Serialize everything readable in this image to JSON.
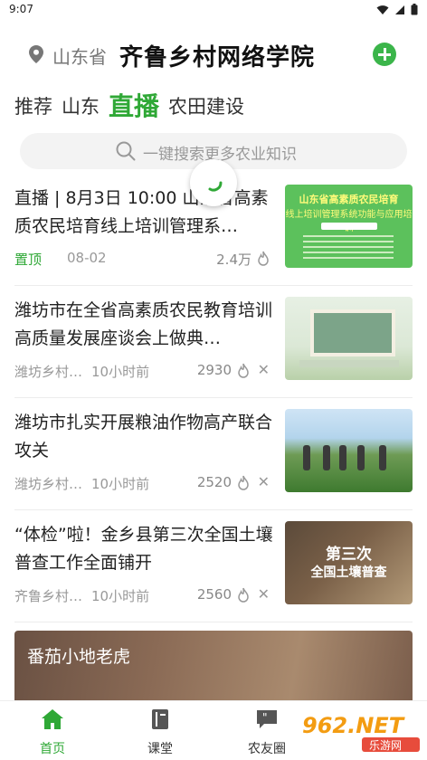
{
  "status_bar": {
    "time": "9:07"
  },
  "header": {
    "location": "山东省",
    "title": "齐鲁乡村网络学院",
    "add_icon": "plus-icon"
  },
  "tabs": [
    {
      "label": "推荐",
      "active": false
    },
    {
      "label": "山东",
      "active": false
    },
    {
      "label": "直播",
      "active": true
    },
    {
      "label": "农田建设",
      "active": false
    }
  ],
  "search": {
    "placeholder": "一键搜索更多农业知识"
  },
  "feed": [
    {
      "title": "直播 | 8月3日 10:00 山东省高素质农民培育线上培训管理系…",
      "source": "置顶",
      "time": "08-02",
      "heat": "2.4万",
      "thumb": {
        "heading": "山东省高素质农民培育",
        "subheading": "线上培训管理系统功能与应用培训"
      }
    },
    {
      "title": "潍坊市在全省高素质农民教育培训高质量发展座谈会上做典…",
      "source": "潍坊乡村…",
      "time": "10小时前",
      "heat": "2930"
    },
    {
      "title": "潍坊市扎实开展粮油作物高产联合攻关",
      "source": "潍坊乡村…",
      "time": "10小时前",
      "heat": "2520"
    },
    {
      "title": "“体检”啦！金乡县第三次全国土壤普查工作全面铺开",
      "source": "齐鲁乡村…",
      "time": "10小时前",
      "heat": "2560",
      "thumb": {
        "line1": "第三次",
        "line2": "全国土壤普查"
      }
    }
  ],
  "banner": {
    "title": "番茄小地老虎"
  },
  "bottom_nav": [
    {
      "label": "首页",
      "icon": "home-icon",
      "active": true
    },
    {
      "label": "课堂",
      "icon": "book-icon",
      "active": false
    },
    {
      "label": "农友圈",
      "icon": "chat-quote-icon",
      "active": false
    }
  ],
  "watermark": {
    "text": "962.NET",
    "subtext": "乐游网"
  },
  "colors": {
    "accent": "#2fa836",
    "add_button": "#3bb54a"
  }
}
